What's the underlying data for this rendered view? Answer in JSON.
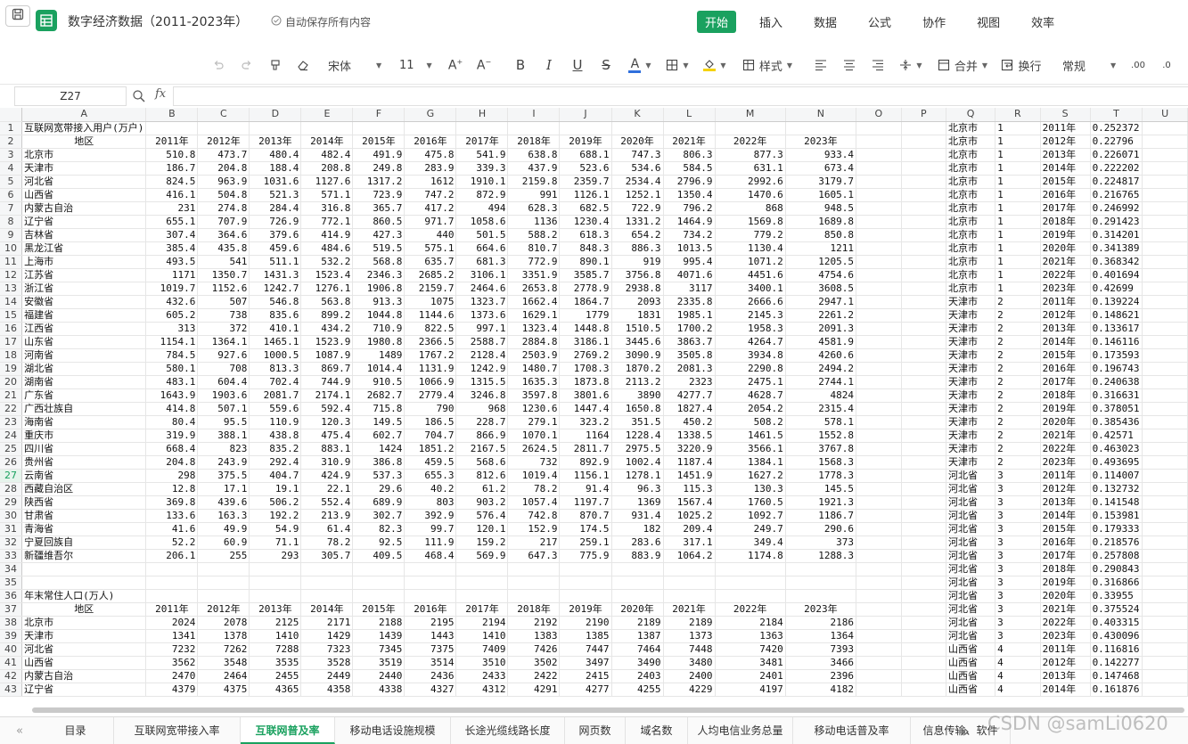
{
  "document": {
    "title": "数字经济数据（2011-2023年）",
    "autosave": "自动保存所有内容"
  },
  "menu": [
    {
      "label": "开始",
      "active": true
    },
    {
      "label": "插入"
    },
    {
      "label": "数据"
    },
    {
      "label": "公式"
    },
    {
      "label": "协作"
    },
    {
      "label": "视图"
    },
    {
      "label": "效率"
    }
  ],
  "toolbar": {
    "font_name": "宋体",
    "font_size": "11",
    "style_label": "样式",
    "merge_label": "合并",
    "wrap_label": "换行",
    "number_format": "常规",
    "text_color": "#2f6fdc",
    "fill_color": "#f5d200",
    "icons": [
      "undo-icon",
      "redo-icon",
      "format-painter-icon",
      "clear-format-icon",
      "font-increase-icon",
      "font-decrease-icon",
      "bold-icon",
      "italic-icon",
      "underline-icon",
      "strikethrough-icon",
      "font-color-icon",
      "border-icon",
      "fill-color-icon",
      "table-style-icon",
      "align-left-icon",
      "align-center-icon",
      "align-right-icon",
      "vertical-align-icon",
      "merge-icon",
      "wrap-text-icon",
      "decimal-decrease-icon",
      "decimal-increase-icon"
    ]
  },
  "formula_bar": {
    "name_box": "Z27",
    "formula": ""
  },
  "columns": [
    "A",
    "B",
    "C",
    "D",
    "E",
    "F",
    "G",
    "H",
    "I",
    "J",
    "K",
    "L",
    "M",
    "N",
    "O",
    "P",
    "Q",
    "R",
    "S",
    "T",
    "U"
  ],
  "selected_row": 27,
  "sheet": {
    "section1_title": "互联网宽带接入用户(万户)",
    "section2_title": "年末常住人口(万人)",
    "header": [
      "地区",
      "2011年",
      "2012年",
      "2013年",
      "2014年",
      "2015年",
      "2016年",
      "2017年",
      "2018年",
      "2019年",
      "2020年",
      "2021年",
      "2022年",
      "2023年"
    ],
    "broadband": [
      [
        "北京市",
        "510.8",
        "473.7",
        "480.4",
        "482.4",
        "491.9",
        "475.8",
        "541.9",
        "638.8",
        "688.1",
        "747.3",
        "806.3",
        "877.3",
        "933.4"
      ],
      [
        "天津市",
        "186.7",
        "204.8",
        "188.4",
        "208.8",
        "249.8",
        "283.9",
        "339.3",
        "437.9",
        "523.6",
        "534.6",
        "584.5",
        "631.1",
        "673.4"
      ],
      [
        "河北省",
        "824.5",
        "963.9",
        "1031.6",
        "1127.6",
        "1317.2",
        "1612",
        "1910.1",
        "2159.8",
        "2359.7",
        "2534.4",
        "2796.9",
        "2992.6",
        "3179.7"
      ],
      [
        "山西省",
        "416.1",
        "504.8",
        "521.3",
        "571.1",
        "723.9",
        "747.2",
        "872.9",
        "991",
        "1126.1",
        "1252.1",
        "1350.4",
        "1470.6",
        "1605.1"
      ],
      [
        "内蒙古自治",
        "231",
        "274.8",
        "284.4",
        "316.8",
        "365.7",
        "417.2",
        "494",
        "628.3",
        "682.5",
        "722.9",
        "796.2",
        "868",
        "948.5"
      ],
      [
        "辽宁省",
        "655.1",
        "707.9",
        "726.9",
        "772.1",
        "860.5",
        "971.7",
        "1058.6",
        "1136",
        "1230.4",
        "1331.2",
        "1464.9",
        "1569.8",
        "1689.8"
      ],
      [
        "吉林省",
        "307.4",
        "364.6",
        "379.6",
        "414.9",
        "427.3",
        "440",
        "501.5",
        "588.2",
        "618.3",
        "654.2",
        "734.2",
        "779.2",
        "850.8"
      ],
      [
        "黑龙江省",
        "385.4",
        "435.8",
        "459.6",
        "484.6",
        "519.5",
        "575.1",
        "664.6",
        "810.7",
        "848.3",
        "886.3",
        "1013.5",
        "1130.4",
        "1211"
      ],
      [
        "上海市",
        "493.5",
        "541",
        "511.1",
        "532.2",
        "568.8",
        "635.7",
        "681.3",
        "772.9",
        "890.1",
        "919",
        "995.4",
        "1071.2",
        "1205.5"
      ],
      [
        "江苏省",
        "1171",
        "1350.7",
        "1431.3",
        "1523.4",
        "2346.3",
        "2685.2",
        "3106.1",
        "3351.9",
        "3585.7",
        "3756.8",
        "4071.6",
        "4451.6",
        "4754.6"
      ],
      [
        "浙江省",
        "1019.7",
        "1152.6",
        "1242.7",
        "1276.1",
        "1906.8",
        "2159.7",
        "2464.6",
        "2653.8",
        "2778.9",
        "2938.8",
        "3117",
        "3400.1",
        "3608.5"
      ],
      [
        "安徽省",
        "432.6",
        "507",
        "546.8",
        "563.8",
        "913.3",
        "1075",
        "1323.7",
        "1662.4",
        "1864.7",
        "2093",
        "2335.8",
        "2666.6",
        "2947.1"
      ],
      [
        "福建省",
        "605.2",
        "738",
        "835.6",
        "899.2",
        "1044.8",
        "1144.6",
        "1373.6",
        "1629.1",
        "1779",
        "1831",
        "1985.1",
        "2145.3",
        "2261.2"
      ],
      [
        "江西省",
        "313",
        "372",
        "410.1",
        "434.2",
        "710.9",
        "822.5",
        "997.1",
        "1323.4",
        "1448.8",
        "1510.5",
        "1700.2",
        "1958.3",
        "2091.3"
      ],
      [
        "山东省",
        "1154.1",
        "1364.1",
        "1465.1",
        "1523.9",
        "1980.8",
        "2366.5",
        "2588.7",
        "2884.8",
        "3186.1",
        "3445.6",
        "3863.7",
        "4264.7",
        "4581.9"
      ],
      [
        "河南省",
        "784.5",
        "927.6",
        "1000.5",
        "1087.9",
        "1489",
        "1767.2",
        "2128.4",
        "2503.9",
        "2769.2",
        "3090.9",
        "3505.8",
        "3934.8",
        "4260.6"
      ],
      [
        "湖北省",
        "580.1",
        "708",
        "813.3",
        "869.7",
        "1014.4",
        "1131.9",
        "1242.9",
        "1480.7",
        "1708.3",
        "1870.2",
        "2081.3",
        "2290.8",
        "2494.2"
      ],
      [
        "湖南省",
        "483.1",
        "604.4",
        "702.4",
        "744.9",
        "910.5",
        "1066.9",
        "1315.5",
        "1635.3",
        "1873.8",
        "2113.2",
        "2323",
        "2475.1",
        "2744.1"
      ],
      [
        "广东省",
        "1643.9",
        "1903.6",
        "2081.7",
        "2174.1",
        "2682.7",
        "2779.4",
        "3246.8",
        "3597.8",
        "3801.6",
        "3890",
        "4277.7",
        "4628.7",
        "4824"
      ],
      [
        "广西壮族自",
        "414.8",
        "507.1",
        "559.6",
        "592.4",
        "715.8",
        "790",
        "968",
        "1230.6",
        "1447.4",
        "1650.8",
        "1827.4",
        "2054.2",
        "2315.4"
      ],
      [
        "海南省",
        "80.4",
        "95.5",
        "110.9",
        "120.3",
        "149.5",
        "186.5",
        "228.7",
        "279.1",
        "323.2",
        "351.5",
        "450.2",
        "508.2",
        "578.1"
      ],
      [
        "重庆市",
        "319.9",
        "388.1",
        "438.8",
        "475.4",
        "602.7",
        "704.7",
        "866.9",
        "1070.1",
        "1164",
        "1228.4",
        "1338.5",
        "1461.5",
        "1552.8"
      ],
      [
        "四川省",
        "668.4",
        "823",
        "835.2",
        "883.1",
        "1424",
        "1851.2",
        "2167.5",
        "2624.5",
        "2811.7",
        "2975.5",
        "3220.9",
        "3566.1",
        "3767.8"
      ],
      [
        "贵州省",
        "204.8",
        "243.9",
        "292.4",
        "310.9",
        "386.8",
        "459.5",
        "568.6",
        "732",
        "892.9",
        "1002.4",
        "1187.4",
        "1384.1",
        "1568.3"
      ],
      [
        "云南省",
        "298",
        "375.5",
        "404.7",
        "424.9",
        "537.3",
        "655.3",
        "812.6",
        "1019.4",
        "1156.1",
        "1278.1",
        "1451.9",
        "1627.2",
        "1778.3"
      ],
      [
        "西藏自治区",
        "12.8",
        "17.1",
        "19.1",
        "22.1",
        "29.6",
        "40.2",
        "61.2",
        "78.2",
        "91.4",
        "96.3",
        "115.3",
        "130.3",
        "145.5"
      ],
      [
        "陕西省",
        "369.8",
        "439.6",
        "506.2",
        "552.4",
        "689.9",
        "803",
        "903.2",
        "1057.4",
        "1197.7",
        "1369",
        "1567.4",
        "1760.5",
        "1921.3"
      ],
      [
        "甘肃省",
        "133.6",
        "163.3",
        "192.2",
        "213.9",
        "302.7",
        "392.9",
        "576.4",
        "742.8",
        "870.7",
        "931.4",
        "1025.2",
        "1092.7",
        "1186.7"
      ],
      [
        "青海省",
        "41.6",
        "49.9",
        "54.9",
        "61.4",
        "82.3",
        "99.7",
        "120.1",
        "152.9",
        "174.5",
        "182",
        "209.4",
        "249.7",
        "290.6"
      ],
      [
        "宁夏回族自",
        "52.2",
        "60.9",
        "71.1",
        "78.2",
        "92.5",
        "111.9",
        "159.2",
        "217",
        "259.1",
        "283.6",
        "317.1",
        "349.4",
        "373"
      ],
      [
        "新疆维吾尔",
        "206.1",
        "255",
        "293",
        "305.7",
        "409.5",
        "468.4",
        "569.9",
        "647.3",
        "775.9",
        "883.9",
        "1064.2",
        "1174.8",
        "1288.3"
      ]
    ],
    "population": [
      [
        "北京市",
        "2024",
        "2078",
        "2125",
        "2171",
        "2188",
        "2195",
        "2194",
        "2192",
        "2190",
        "2189",
        "2189",
        "2184",
        "2186"
      ],
      [
        "天津市",
        "1341",
        "1378",
        "1410",
        "1429",
        "1439",
        "1443",
        "1410",
        "1383",
        "1385",
        "1387",
        "1373",
        "1363",
        "1364"
      ],
      [
        "河北省",
        "7232",
        "7262",
        "7288",
        "7323",
        "7345",
        "7375",
        "7409",
        "7426",
        "7447",
        "7464",
        "7448",
        "7420",
        "7393"
      ],
      [
        "山西省",
        "3562",
        "3548",
        "3535",
        "3528",
        "3519",
        "3514",
        "3510",
        "3502",
        "3497",
        "3490",
        "3480",
        "3481",
        "3466"
      ],
      [
        "内蒙古自治",
        "2470",
        "2464",
        "2455",
        "2449",
        "2440",
        "2436",
        "2433",
        "2422",
        "2415",
        "2403",
        "2400",
        "2401",
        "2396"
      ],
      [
        "辽宁省",
        "4379",
        "4375",
        "4365",
        "4358",
        "4338",
        "4327",
        "4312",
        "4291",
        "4277",
        "4255",
        "4229",
        "4197",
        "4182"
      ]
    ],
    "panel": [
      [
        "北京市",
        "1",
        "2011年",
        "0.252372"
      ],
      [
        "北京市",
        "1",
        "2012年",
        "0.22796"
      ],
      [
        "北京市",
        "1",
        "2013年",
        "0.226071"
      ],
      [
        "北京市",
        "1",
        "2014年",
        "0.222202"
      ],
      [
        "北京市",
        "1",
        "2015年",
        "0.224817"
      ],
      [
        "北京市",
        "1",
        "2016年",
        "0.216765"
      ],
      [
        "北京市",
        "1",
        "2017年",
        "0.246992"
      ],
      [
        "北京市",
        "1",
        "2018年",
        "0.291423"
      ],
      [
        "北京市",
        "1",
        "2019年",
        "0.314201"
      ],
      [
        "北京市",
        "1",
        "2020年",
        "0.341389"
      ],
      [
        "北京市",
        "1",
        "2021年",
        "0.368342"
      ],
      [
        "北京市",
        "1",
        "2022年",
        "0.401694"
      ],
      [
        "北京市",
        "1",
        "2023年",
        "0.42699"
      ],
      [
        "天津市",
        "2",
        "2011年",
        "0.139224"
      ],
      [
        "天津市",
        "2",
        "2012年",
        "0.148621"
      ],
      [
        "天津市",
        "2",
        "2013年",
        "0.133617"
      ],
      [
        "天津市",
        "2",
        "2014年",
        "0.146116"
      ],
      [
        "天津市",
        "2",
        "2015年",
        "0.173593"
      ],
      [
        "天津市",
        "2",
        "2016年",
        "0.196743"
      ],
      [
        "天津市",
        "2",
        "2017年",
        "0.240638"
      ],
      [
        "天津市",
        "2",
        "2018年",
        "0.316631"
      ],
      [
        "天津市",
        "2",
        "2019年",
        "0.378051"
      ],
      [
        "天津市",
        "2",
        "2020年",
        "0.385436"
      ],
      [
        "天津市",
        "2",
        "2021年",
        "0.42571"
      ],
      [
        "天津市",
        "2",
        "2022年",
        "0.463023"
      ],
      [
        "天津市",
        "2",
        "2023年",
        "0.493695"
      ],
      [
        "河北省",
        "3",
        "2011年",
        "0.114007"
      ],
      [
        "河北省",
        "3",
        "2012年",
        "0.132732"
      ],
      [
        "河北省",
        "3",
        "2013年",
        "0.141548"
      ],
      [
        "河北省",
        "3",
        "2014年",
        "0.153981"
      ],
      [
        "河北省",
        "3",
        "2015年",
        "0.179333"
      ],
      [
        "河北省",
        "3",
        "2016年",
        "0.218576"
      ],
      [
        "河北省",
        "3",
        "2017年",
        "0.257808"
      ],
      [
        "河北省",
        "3",
        "2018年",
        "0.290843"
      ],
      [
        "河北省",
        "3",
        "2019年",
        "0.316866"
      ],
      [
        "河北省",
        "3",
        "2020年",
        "0.33955"
      ],
      [
        "河北省",
        "3",
        "2021年",
        "0.375524"
      ],
      [
        "河北省",
        "3",
        "2022年",
        "0.403315"
      ],
      [
        "河北省",
        "3",
        "2023年",
        "0.430096"
      ],
      [
        "山西省",
        "4",
        "2011年",
        "0.116816"
      ],
      [
        "山西省",
        "4",
        "2012年",
        "0.142277"
      ],
      [
        "山西省",
        "4",
        "2013年",
        "0.147468"
      ],
      [
        "山西省",
        "4",
        "2014年",
        "0.161876"
      ]
    ]
  },
  "sheet_tabs": [
    {
      "label": "目录"
    },
    {
      "label": "互联网宽带接入率"
    },
    {
      "label": "互联网普及率",
      "active": true
    },
    {
      "label": "移动电话设施规模"
    },
    {
      "label": "长途光缆线路长度"
    },
    {
      "label": "网页数"
    },
    {
      "label": "域名数"
    },
    {
      "label": "人均电信业务总量"
    },
    {
      "label": "移动电话普及率"
    },
    {
      "label": "信息传输、软件"
    }
  ],
  "watermark": "CSDN @samLi0620",
  "accent_color": "#1aa15f"
}
